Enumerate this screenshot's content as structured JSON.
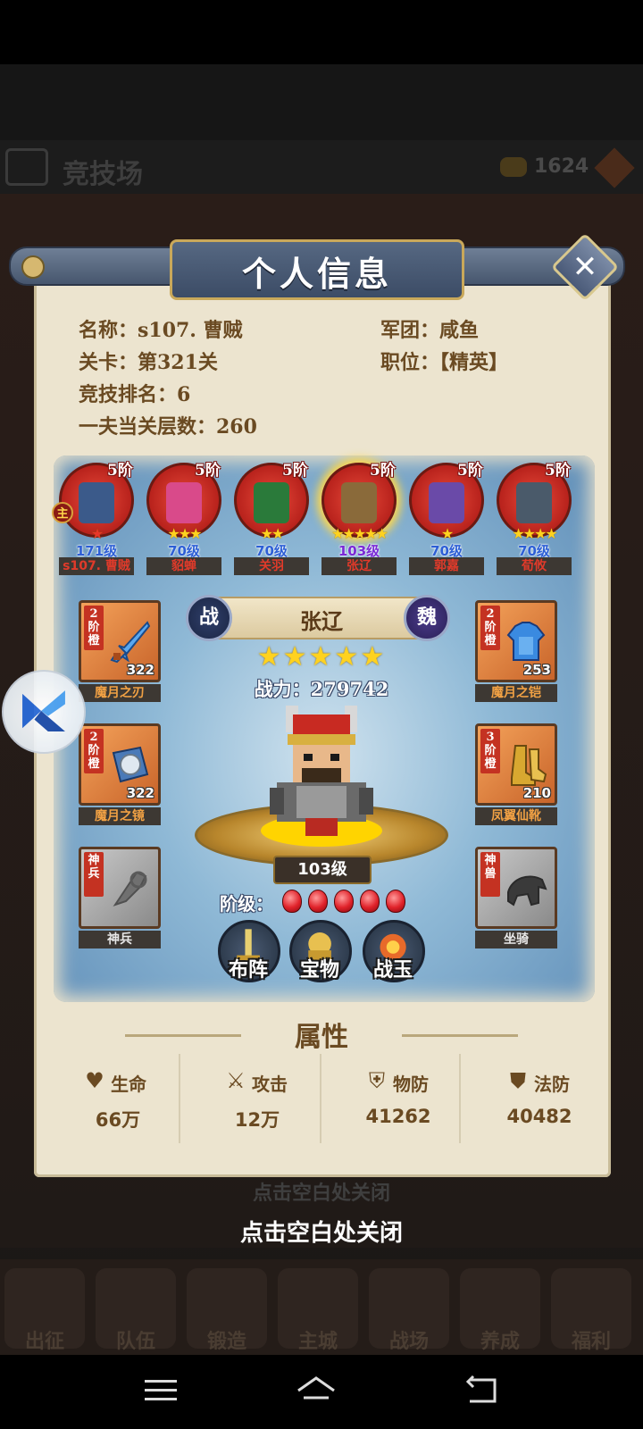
{
  "background": {
    "title": "竞技场",
    "gold": "1624",
    "close_hint_ghost": "点击空白处关闭",
    "nav": [
      "出征",
      "队伍",
      "锻造",
      "主城",
      "战场",
      "养成",
      "福利"
    ]
  },
  "popup": {
    "title": "个人信息",
    "info": {
      "name": "名称：s107. 曹贼",
      "legion": "军团：咸鱼",
      "stage": "关卡：第321关",
      "position": "职位：【精英】",
      "arena_rank": "竞技排名：6",
      "tower_floors": "一夫当关层数：260"
    },
    "heroes": [
      {
        "name": "s107. 曹贼",
        "level": "171级",
        "tier": "5阶",
        "stars": "★",
        "main": "主",
        "sprite_color": "#3b5a8a",
        "level_color": "#2d5fd6"
      },
      {
        "name": "貂蝉",
        "level": "70级",
        "tier": "5阶",
        "stars": "★★★",
        "sprite_color": "#d94a8a",
        "level_color": "#2d5fd6"
      },
      {
        "name": "关羽",
        "level": "70级",
        "tier": "5阶",
        "stars": "★★",
        "sprite_color": "#2a7a3a",
        "level_color": "#2d5fd6"
      },
      {
        "name": "张辽",
        "level": "103级",
        "tier": "5阶",
        "stars": "★★★★★",
        "sprite_color": "#8a6a3a",
        "level_color": "#7a2ad6"
      },
      {
        "name": "郭嘉",
        "level": "70级",
        "tier": "5阶",
        "stars": "★",
        "sprite_color": "#6a4aa8",
        "level_color": "#2d5fd6"
      },
      {
        "name": "荀攸",
        "level": "70级",
        "tier": "5阶",
        "stars": "★★★★",
        "sprite_color": "#4a5a6a",
        "level_color": "#2d5fd6"
      }
    ],
    "selected_hero": {
      "faction_left": "战",
      "name": "张辽",
      "faction_right": "魏",
      "stars": "★★★★★",
      "power": "战力：279742",
      "level": "103级",
      "tier_label": "阶级：",
      "tier_gems": 5
    },
    "equipment_left": [
      {
        "name": "魔月之刃",
        "tier_tag": "2阶橙",
        "value": "322"
      },
      {
        "name": "魔月之镜",
        "tier_tag": "2阶橙",
        "value": "322"
      },
      {
        "name": "神兵",
        "tier_tag": "神兵"
      }
    ],
    "equipment_right": [
      {
        "name": "魔月之铠",
        "tier_tag": "2阶橙",
        "value": "253"
      },
      {
        "name": "凤翼仙靴",
        "tier_tag": "3阶橙",
        "value": "210"
      },
      {
        "name": "坐骑",
        "tier_tag": "神兽"
      }
    ],
    "buttons": {
      "formation": "布阵",
      "treasure": "宝物",
      "jade": "战玉"
    },
    "attributes": {
      "title": "属性",
      "items": [
        {
          "label": "生命",
          "value": "66万",
          "icon": "heart-icon"
        },
        {
          "label": "攻击",
          "value": "12万",
          "icon": "crossed-swords-icon"
        },
        {
          "label": "物防",
          "value": "41262",
          "icon": "armor-icon"
        },
        {
          "label": "法防",
          "value": "40482",
          "icon": "magic-shield-icon"
        }
      ]
    }
  },
  "close_hint": "点击空白处关闭",
  "colors": {
    "panel_bg": "#ece4cf",
    "text_brown": "#6a4a22",
    "hero_ring": "#b8221c",
    "star": "#ffd21f",
    "equip_orange": "#f4a25a"
  }
}
